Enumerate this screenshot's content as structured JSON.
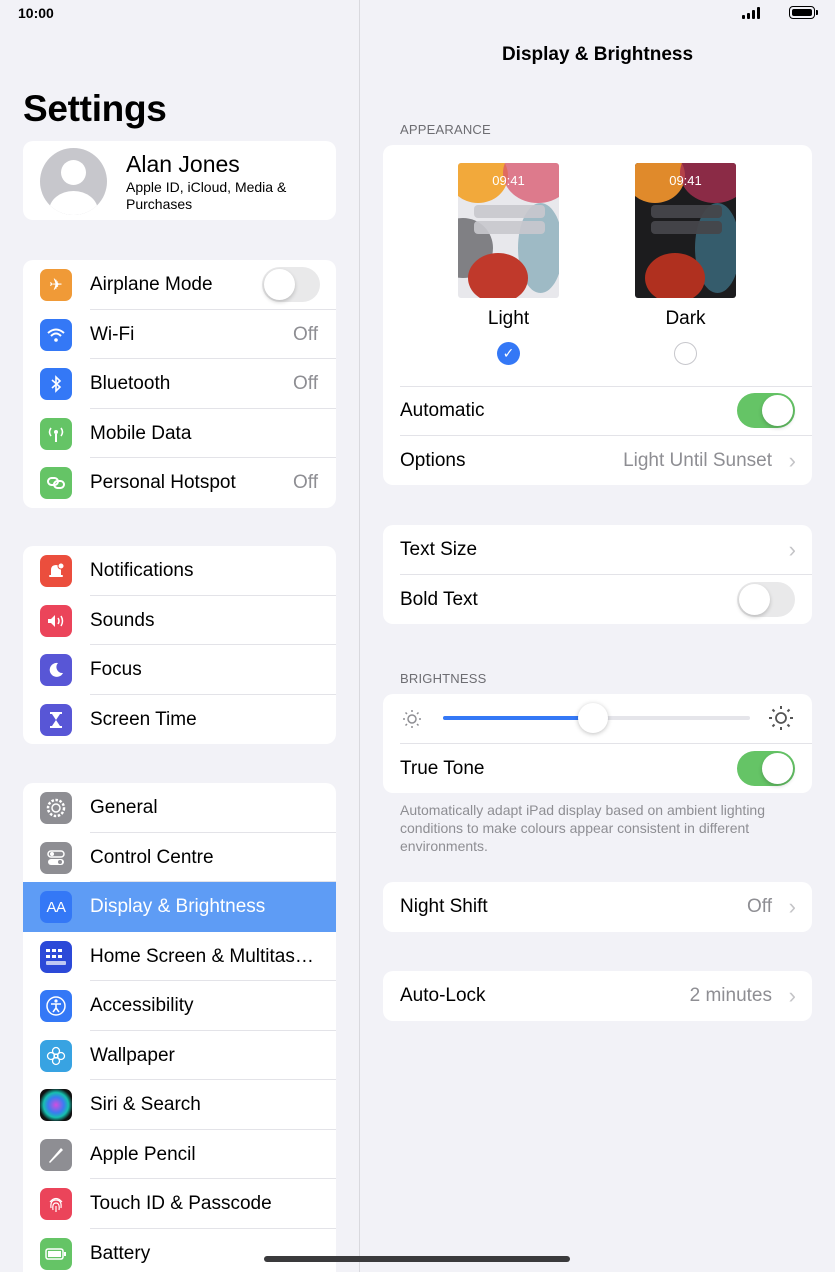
{
  "status": {
    "time": "10:00"
  },
  "sidebar": {
    "title": "Settings",
    "profile": {
      "name": "Alan Jones",
      "subtitle": "Apple ID, iCloud, Media & Purchases"
    },
    "group1": [
      {
        "label": "Airplane Mode",
        "icon": "airplane-icon",
        "color": "#f09a37",
        "toggle": "off"
      },
      {
        "label": "Wi-Fi",
        "icon": "wifi-icon",
        "color": "#3478f6",
        "value": "Off"
      },
      {
        "label": "Bluetooth",
        "icon": "bluetooth-icon",
        "color": "#3478f6",
        "value": "Off"
      },
      {
        "label": "Mobile Data",
        "icon": "antenna-icon",
        "color": "#65c466"
      },
      {
        "label": "Personal Hotspot",
        "icon": "hotspot-icon",
        "color": "#65c466",
        "value": "Off"
      }
    ],
    "group2": [
      {
        "label": "Notifications",
        "icon": "bell-icon",
        "color": "#eb4e3d"
      },
      {
        "label": "Sounds",
        "icon": "speaker-icon",
        "color": "#eb445a"
      },
      {
        "label": "Focus",
        "icon": "moon-icon",
        "color": "#5856d6"
      },
      {
        "label": "Screen Time",
        "icon": "hourglass-icon",
        "color": "#5856d6"
      }
    ],
    "group3": [
      {
        "label": "General",
        "icon": "gear-icon",
        "color": "#8e8e93"
      },
      {
        "label": "Control Centre",
        "icon": "switches-icon",
        "color": "#8e8e93"
      },
      {
        "label": "Display & Brightness",
        "icon": "text-size-icon",
        "color": "#3478f6",
        "selected": true
      },
      {
        "label": "Home Screen & Multitas…",
        "icon": "home-grid-icon",
        "color": "#2c49d8"
      },
      {
        "label": "Accessibility",
        "icon": "accessibility-icon",
        "color": "#3478f6"
      },
      {
        "label": "Wallpaper",
        "icon": "flower-icon",
        "color": "#38a3e2"
      },
      {
        "label": "Siri & Search",
        "icon": "siri-icon",
        "color": "#222222"
      },
      {
        "label": "Apple Pencil",
        "icon": "pencil-icon",
        "color": "#8e8e93"
      },
      {
        "label": "Touch ID & Passcode",
        "icon": "fingerprint-icon",
        "color": "#eb445a"
      },
      {
        "label": "Battery",
        "icon": "battery-icon",
        "color": "#65c466"
      }
    ]
  },
  "detail": {
    "title": "Display & Brightness",
    "appearance_header": "APPEARANCE",
    "preview_time": "09:41",
    "light_label": "Light",
    "dark_label": "Dark",
    "selected_appearance": "Light",
    "automatic_label": "Automatic",
    "automatic_toggle": "on",
    "options_label": "Options",
    "options_value": "Light Until Sunset",
    "text_size_label": "Text Size",
    "bold_text_label": "Bold Text",
    "bold_text_toggle": "off",
    "brightness_header": "BRIGHTNESS",
    "brightness_level": 0.49,
    "true_tone_label": "True Tone",
    "true_tone_toggle": "on",
    "true_tone_footnote": "Automatically adapt iPad display based on ambient lighting conditions to make colours appear consistent in different environments.",
    "night_shift_label": "Night Shift",
    "night_shift_value": "Off",
    "auto_lock_label": "Auto-Lock",
    "auto_lock_value": "2 minutes"
  }
}
